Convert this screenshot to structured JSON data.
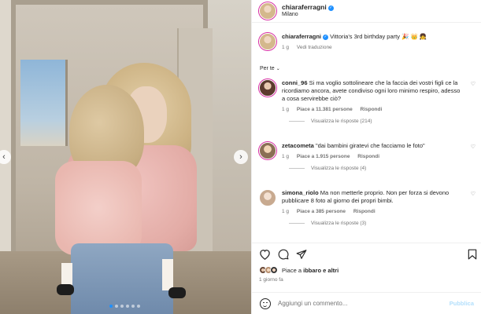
{
  "post": {
    "username": "chiaraferragni",
    "location": "Milano",
    "caption": "Vittoria's 3rd birthday party 🎉 👑 👧",
    "caption_age": "1 g",
    "translate": "Vedi traduzione"
  },
  "section_label": "Per te",
  "comments": [
    {
      "username": "conni_96",
      "text": "Si ma voglio sottolineare che la faccia dei vostri figli ce la ricordiamo ancora, avete condiviso ogni loro minimo respiro, adesso a cosa servirebbe ciò?",
      "age": "1 g",
      "likes": "Piace a 11.381 persone",
      "reply": "Rispondi",
      "view_replies": "Visualizza le risposte (214)"
    },
    {
      "username": "zetacometa",
      "text": "\"dai bambini giratevi che facciamo le foto\"",
      "age": "1 g",
      "likes": "Piace a 1.915 persone",
      "reply": "Rispondi",
      "view_replies": "Visualizza le risposte (4)"
    },
    {
      "username": "simona_riolo",
      "text": "Ma non metterle proprio. Non per forza si devono pubblicare 8 foto al giorno dei propri bimbi.",
      "age": "1 g",
      "likes": "Piace a 385 persone",
      "reply": "Rispondi",
      "view_replies": "Visualizza le risposte (3)"
    }
  ],
  "likes_summary": {
    "prefix": "Piace a",
    "user": "ibbaro",
    "suffix": "e altri"
  },
  "posted_ago": "1 giorno fa",
  "comment_box": {
    "placeholder": "Aggiungi un commento...",
    "publish": "Pubblica"
  },
  "icons": {
    "like": "heart-icon",
    "comment": "comment-icon",
    "share": "share-icon",
    "save": "bookmark-icon",
    "emoji": "emoji-icon"
  },
  "colors": {
    "verified": "#1e90ff",
    "secondary_text": "#737373",
    "publish_disabled": "#b2dffc"
  },
  "carousel": {
    "slides": 6,
    "active_index": 0
  }
}
